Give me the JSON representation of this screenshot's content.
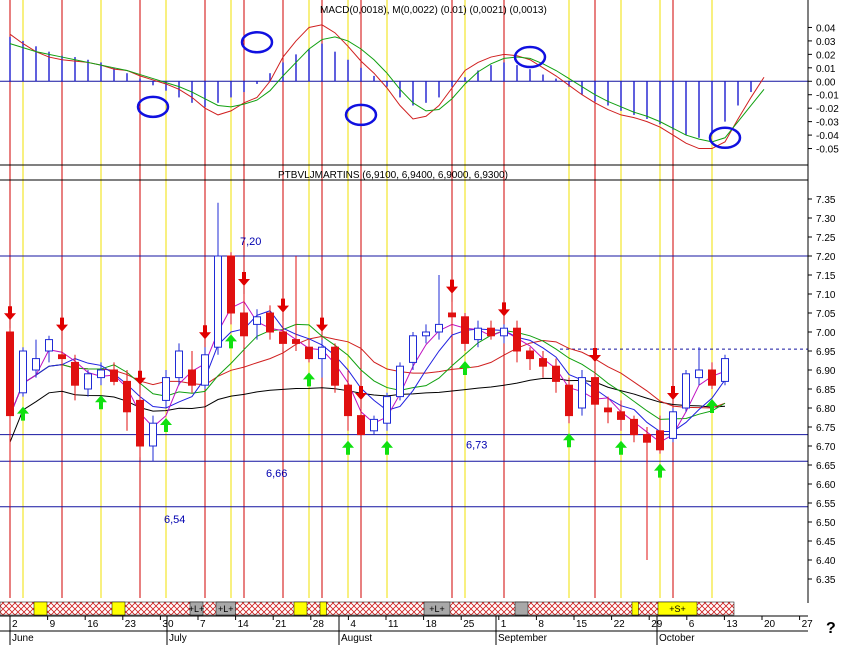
{
  "help_label": "?",
  "colors": {
    "up": "#1f2bd6",
    "down": "#e01010",
    "red_line": "#d00000",
    "yellow_line": "#f0e000",
    "gray_line": "#b8b8c8",
    "level": "#1414a0",
    "ma_black": "#000000",
    "ma_red": "#d02020",
    "ma_green": "#10a010",
    "ma_blue": "#2020e0",
    "ma_magenta": "#c010c0",
    "macd_hist": "#1d1dd0",
    "arrow_up": "#10e010",
    "arrow_down": "#e00000",
    "circle": "#1010e0"
  },
  "chart_data": [
    {
      "id": "macd",
      "type": "line",
      "title": "MACD(0,0018), M(0,0022) (0.01) (0,0021) (0,0013)",
      "ylim": [
        -0.06,
        0.05
      ],
      "y_ticks": [
        "0.04",
        "0.03",
        "0.02",
        "0.01",
        "0.00",
        "-0.01",
        "-0.02",
        "-0.03",
        "-0.04",
        "-0.05"
      ],
      "series": [
        {
          "name": "MACD",
          "values": [
            0.035,
            0.028,
            0.022,
            0.018,
            0.016,
            0.015,
            0.014,
            0.012,
            0.009,
            0.008,
            0.004,
            0.001,
            -0.002,
            -0.006,
            -0.012,
            -0.02,
            -0.025,
            -0.022,
            -0.016,
            -0.012,
            0.0,
            0.018,
            0.03,
            0.04,
            0.042,
            0.036,
            0.026,
            0.015,
            0.006,
            -0.005,
            -0.018,
            -0.028,
            -0.026,
            -0.018,
            -0.005,
            0.008,
            0.014,
            0.018,
            0.02,
            0.019,
            0.016,
            0.01,
            0.004,
            -0.003,
            -0.01,
            -0.016,
            -0.021,
            -0.025,
            -0.027,
            -0.03,
            -0.034,
            -0.04,
            -0.046,
            -0.05,
            -0.05,
            -0.045,
            -0.028,
            -0.012,
            0.003
          ]
        },
        {
          "name": "Signal",
          "values": [
            0.028,
            0.025,
            0.022,
            0.02,
            0.018,
            0.016,
            0.014,
            0.012,
            0.01,
            0.008,
            0.005,
            0.002,
            -0.001,
            -0.004,
            -0.008,
            -0.013,
            -0.018,
            -0.019,
            -0.017,
            -0.014,
            -0.007,
            0.004,
            0.014,
            0.024,
            0.031,
            0.033,
            0.03,
            0.024,
            0.016,
            0.006,
            -0.006,
            -0.016,
            -0.022,
            -0.021,
            -0.013,
            -0.002,
            0.007,
            0.013,
            0.017,
            0.018,
            0.017,
            0.013,
            0.008,
            0.002,
            -0.004,
            -0.01,
            -0.015,
            -0.019,
            -0.023,
            -0.026,
            -0.03,
            -0.035,
            -0.04,
            -0.043,
            -0.045,
            -0.042,
            -0.03,
            -0.018,
            -0.006
          ]
        },
        {
          "name": "Histogram",
          "values": [
            0.033,
            0.03,
            0.026,
            0.022,
            0.019,
            0.018,
            0.016,
            0.014,
            0.01,
            0.006,
            0.002,
            -0.003,
            -0.007,
            -0.012,
            -0.016,
            -0.019,
            -0.016,
            -0.012,
            -0.008,
            -0.002,
            0.006,
            0.014,
            0.02,
            0.024,
            0.028,
            0.022,
            0.016,
            0.01,
            0.004,
            -0.004,
            -0.012,
            -0.018,
            -0.016,
            -0.012,
            -0.004,
            0.003,
            0.008,
            0.012,
            0.014,
            0.012,
            0.009,
            0.005,
            0.002,
            -0.004,
            -0.01,
            -0.015,
            -0.018,
            -0.022,
            -0.025,
            -0.028,
            -0.032,
            -0.036,
            -0.04,
            -0.042,
            -0.038,
            -0.03,
            -0.018,
            -0.008
          ]
        }
      ],
      "highlights": [
        {
          "x": 11,
          "y": -0.019
        },
        {
          "x": 19,
          "y": 0.029
        },
        {
          "x": 27,
          "y": -0.025
        },
        {
          "x": 40,
          "y": 0.018
        },
        {
          "x": 55,
          "y": -0.042
        }
      ]
    },
    {
      "id": "price",
      "type": "candlestick",
      "title": "PTBVLJMARTINS (6,9100, 6,9400, 6,9000, 6,9300)",
      "ylim": [
        6.3,
        7.4
      ],
      "y_ticks": [
        "7.35",
        "7.30",
        "7.25",
        "7.20",
        "7.15",
        "7.10",
        "7.05",
        "7.00",
        "6.95",
        "6.90",
        "6.85",
        "6.80",
        "6.75",
        "6.70",
        "6.65",
        "6.60",
        "6.55",
        "6.50",
        "6.45",
        "6.40",
        "6.35"
      ],
      "x_tick_labels": [
        "2",
        "9",
        "16",
        "23",
        "30",
        "7",
        "14",
        "21",
        "28",
        "4",
        "11",
        "18",
        "25",
        "1",
        "8",
        "15",
        "22",
        "29",
        "6",
        "13",
        "20",
        "27"
      ],
      "month_labels": [
        "June",
        "July",
        "August",
        "September",
        "October"
      ],
      "levels": [
        {
          "value": 7.2,
          "label": "7,20"
        },
        {
          "value": 6.73,
          "label": "6,73"
        },
        {
          "value": 6.66,
          "label": "6,66"
        },
        {
          "value": 6.54,
          "label": "6,54"
        }
      ],
      "last_close": 6.955,
      "candles": [
        {
          "o": 7.0,
          "h": 7.01,
          "l": 6.54,
          "c": 6.78
        },
        {
          "o": 6.84,
          "h": 6.96,
          "l": 6.83,
          "c": 6.95
        },
        {
          "o": 6.9,
          "h": 6.98,
          "l": 6.88,
          "c": 6.93
        },
        {
          "o": 6.95,
          "h": 6.99,
          "l": 6.92,
          "c": 6.98
        },
        {
          "o": 6.94,
          "h": 6.98,
          "l": 6.91,
          "c": 6.93
        },
        {
          "o": 6.92,
          "h": 6.94,
          "l": 6.82,
          "c": 6.86
        },
        {
          "o": 6.85,
          "h": 6.9,
          "l": 6.83,
          "c": 6.89
        },
        {
          "o": 6.88,
          "h": 6.92,
          "l": 6.86,
          "c": 6.9
        },
        {
          "o": 6.9,
          "h": 6.92,
          "l": 6.86,
          "c": 6.87
        },
        {
          "o": 6.87,
          "h": 6.9,
          "l": 6.74,
          "c": 6.79
        },
        {
          "o": 6.82,
          "h": 6.84,
          "l": 6.67,
          "c": 6.7
        },
        {
          "o": 6.7,
          "h": 6.78,
          "l": 6.66,
          "c": 6.76
        },
        {
          "o": 6.82,
          "h": 6.9,
          "l": 6.8,
          "c": 6.88
        },
        {
          "o": 6.88,
          "h": 6.97,
          "l": 6.86,
          "c": 6.95
        },
        {
          "o": 6.9,
          "h": 6.95,
          "l": 6.84,
          "c": 6.86
        },
        {
          "o": 6.86,
          "h": 6.96,
          "l": 6.85,
          "c": 6.94
        },
        {
          "o": 6.96,
          "h": 7.34,
          "l": 6.94,
          "c": 7.2
        },
        {
          "o": 7.2,
          "h": 7.21,
          "l": 7.02,
          "c": 7.05
        },
        {
          "o": 7.05,
          "h": 7.1,
          "l": 6.96,
          "c": 6.99
        },
        {
          "o": 7.02,
          "h": 7.06,
          "l": 6.98,
          "c": 7.04
        },
        {
          "o": 7.05,
          "h": 7.07,
          "l": 6.98,
          "c": 7.0
        },
        {
          "o": 7.0,
          "h": 7.03,
          "l": 6.96,
          "c": 6.97
        },
        {
          "o": 6.98,
          "h": 7.2,
          "l": 6.95,
          "c": 6.97
        },
        {
          "o": 6.96,
          "h": 6.98,
          "l": 6.92,
          "c": 6.93
        },
        {
          "o": 6.93,
          "h": 6.98,
          "l": 6.88,
          "c": 6.96
        },
        {
          "o": 6.96,
          "h": 6.97,
          "l": 6.84,
          "c": 6.86
        },
        {
          "o": 6.86,
          "h": 6.9,
          "l": 6.74,
          "c": 6.78
        },
        {
          "o": 6.78,
          "h": 6.8,
          "l": 6.73,
          "c": 6.73
        },
        {
          "o": 6.74,
          "h": 6.78,
          "l": 6.73,
          "c": 6.77
        },
        {
          "o": 6.76,
          "h": 6.84,
          "l": 6.74,
          "c": 6.83
        },
        {
          "o": 6.83,
          "h": 6.92,
          "l": 6.82,
          "c": 6.91
        },
        {
          "o": 6.92,
          "h": 7.0,
          "l": 6.9,
          "c": 6.99
        },
        {
          "o": 6.99,
          "h": 7.02,
          "l": 6.97,
          "c": 7.0
        },
        {
          "o": 7.0,
          "h": 7.15,
          "l": 6.98,
          "c": 7.02
        },
        {
          "o": 7.05,
          "h": 7.08,
          "l": 7.0,
          "c": 7.04
        },
        {
          "o": 7.04,
          "h": 7.05,
          "l": 6.95,
          "c": 6.97
        },
        {
          "o": 6.98,
          "h": 7.03,
          "l": 6.96,
          "c": 7.01
        },
        {
          "o": 7.01,
          "h": 7.03,
          "l": 6.98,
          "c": 6.99
        },
        {
          "o": 6.99,
          "h": 7.02,
          "l": 6.97,
          "c": 7.01
        },
        {
          "o": 7.01,
          "h": 7.03,
          "l": 6.92,
          "c": 6.95
        },
        {
          "o": 6.95,
          "h": 6.96,
          "l": 6.9,
          "c": 6.93
        },
        {
          "o": 6.93,
          "h": 6.95,
          "l": 6.88,
          "c": 6.91
        },
        {
          "o": 6.91,
          "h": 6.93,
          "l": 6.84,
          "c": 6.87
        },
        {
          "o": 6.86,
          "h": 6.88,
          "l": 6.76,
          "c": 6.78
        },
        {
          "o": 6.8,
          "h": 6.9,
          "l": 6.78,
          "c": 6.88
        },
        {
          "o": 6.88,
          "h": 6.9,
          "l": 6.8,
          "c": 6.81
        },
        {
          "o": 6.8,
          "h": 6.83,
          "l": 6.76,
          "c": 6.79
        },
        {
          "o": 6.79,
          "h": 6.82,
          "l": 6.74,
          "c": 6.77
        },
        {
          "o": 6.77,
          "h": 6.78,
          "l": 6.71,
          "c": 6.73
        },
        {
          "o": 6.73,
          "h": 6.75,
          "l": 6.4,
          "c": 6.71
        },
        {
          "o": 6.74,
          "h": 6.78,
          "l": 6.68,
          "c": 6.69
        },
        {
          "o": 6.72,
          "h": 6.8,
          "l": 6.71,
          "c": 6.79
        },
        {
          "o": 6.8,
          "h": 6.9,
          "l": 6.79,
          "c": 6.89
        },
        {
          "o": 6.88,
          "h": 6.96,
          "l": 6.86,
          "c": 6.9
        },
        {
          "o": 6.9,
          "h": 6.92,
          "l": 6.85,
          "c": 6.86
        },
        {
          "o": 6.87,
          "h": 6.94,
          "l": 6.86,
          "c": 6.93
        }
      ],
      "up_arrows": [
        1,
        7,
        12,
        17,
        23,
        26,
        29,
        35,
        43,
        47,
        50,
        54
      ],
      "down_arrows": [
        0,
        4,
        10,
        15,
        18,
        21,
        24,
        27,
        34,
        38,
        45,
        51
      ]
    }
  ],
  "timeline": {
    "segments": [
      {
        "start": 2,
        "end": 3,
        "kind": "yellow",
        "label": ""
      },
      {
        "start": 8,
        "end": 9,
        "kind": "yellow",
        "label": ""
      },
      {
        "start": 14,
        "end": 15,
        "kind": "gray",
        "label": "+L+"
      },
      {
        "start": 16,
        "end": 17.5,
        "kind": "gray",
        "label": "+L+"
      },
      {
        "start": 22,
        "end": 23,
        "kind": "yellow",
        "label": ""
      },
      {
        "start": 24,
        "end": 24.5,
        "kind": "yellow",
        "label": ""
      },
      {
        "start": 32,
        "end": 34,
        "kind": "gray",
        "label": "+L+"
      },
      {
        "start": 39,
        "end": 40,
        "kind": "gray",
        "label": ""
      },
      {
        "start": 48,
        "end": 48.5,
        "kind": "yellow",
        "label": ""
      },
      {
        "start": 50,
        "end": 53,
        "kind": "yellow",
        "label": "+S+"
      }
    ]
  }
}
